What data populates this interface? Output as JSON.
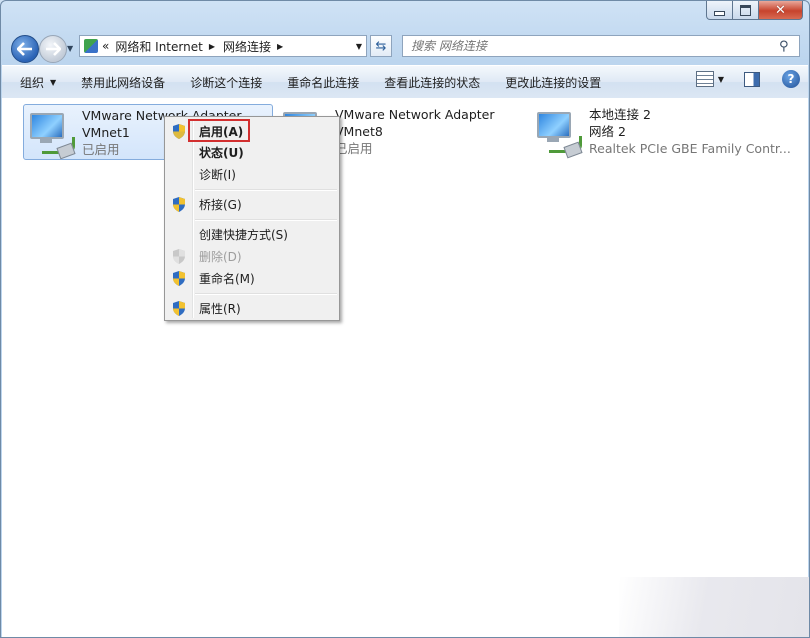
{
  "caption": {
    "minimize": "—",
    "maximize": "□",
    "close": "✕"
  },
  "nav": {
    "back_icon": "back-arrow-icon",
    "forward_icon": "forward-arrow-icon"
  },
  "address": {
    "chevrons": "«",
    "segments": [
      "网络和 Internet",
      "网络连接"
    ]
  },
  "search": {
    "placeholder": "搜索 网络连接"
  },
  "toolbar": {
    "organize": "组织",
    "items": [
      "禁用此网络设备",
      "诊断这个连接",
      "重命名此连接",
      "查看此连接的状态",
      "更改此连接的设置"
    ]
  },
  "adapters": [
    {
      "name": "VMware Network Adapter",
      "sub": "VMnet1",
      "status": "已启用"
    },
    {
      "name": "VMware Network Adapter",
      "sub": "VMnet8",
      "status": "已启用"
    },
    {
      "name": "本地连接 2",
      "sub": "网络  2",
      "status": "Realtek PCIe GBE Family Contr..."
    }
  ],
  "context_menu": {
    "enable": "启用(A)",
    "status": "状态(U)",
    "diagnose": "诊断(I)",
    "bridge": "桥接(G)",
    "shortcut": "创建快捷方式(S)",
    "delete": "删除(D)",
    "rename": "重命名(M)",
    "properties": "属性(R)"
  },
  "colors": {
    "highlight_box": "#d22f2f",
    "shield_blue": "#2f6dc2",
    "shield_yellow": "#f2c230"
  }
}
